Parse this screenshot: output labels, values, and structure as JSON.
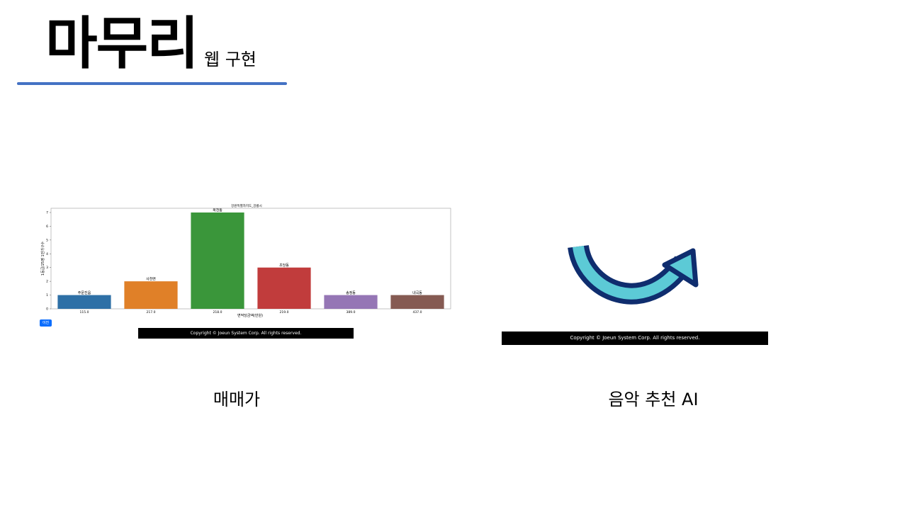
{
  "slide": {
    "title": "마무리",
    "subtitle": "웹 구현",
    "accent_color": "#4472c4"
  },
  "left_panel": {
    "button_label": "이전",
    "footer_text": "Copyright © Joeun System Corp. All rights reserved.",
    "caption": "매매가"
  },
  "right_panel": {
    "icon": "curved-arrow-icon",
    "footer_text": "Copyright © Joeun System Corp. All rights reserved.",
    "caption": "음악 추천 AI"
  },
  "chart_data": {
    "type": "bar",
    "title": "강원특별자치도_강릉시",
    "xlabel": "면적당금액(만원)",
    "ylabel": "1등급/25평 1인가구수",
    "categories": [
      "115.0",
      "217.0",
      "218.0",
      "219.0",
      "389.0",
      "437.0"
    ],
    "bar_labels": [
      "주문진읍",
      "사천면",
      "옥천동",
      "초당동",
      "송정동",
      "내곡동"
    ],
    "values": [
      1,
      2,
      7,
      3,
      1,
      1
    ],
    "colors": [
      "#2e70a6",
      "#e08028",
      "#3a963a",
      "#c13c3c",
      "#9576b5",
      "#855a52"
    ],
    "ylim": [
      0,
      7
    ],
    "yticks": [
      0,
      1,
      2,
      3,
      4,
      5,
      6,
      7
    ],
    "grid": false
  }
}
